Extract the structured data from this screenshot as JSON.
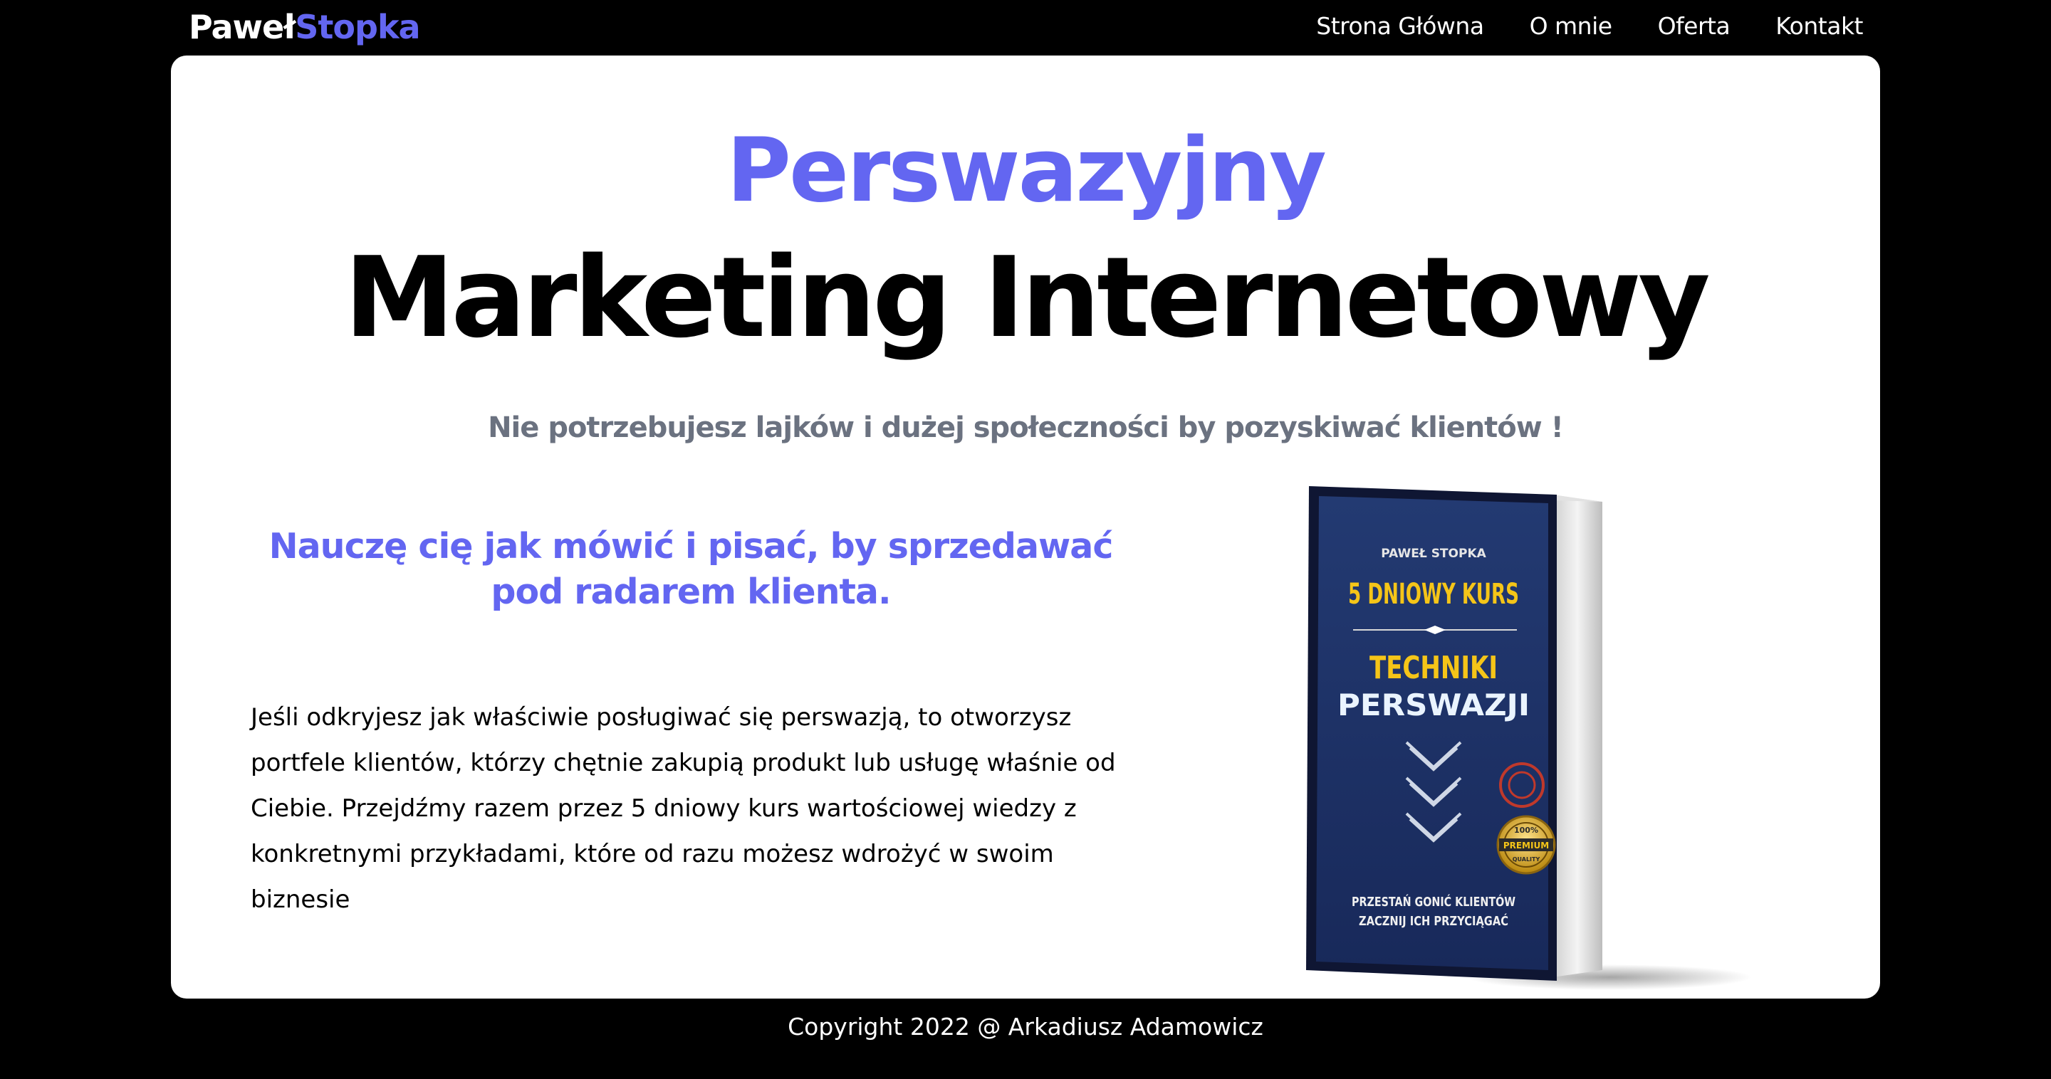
{
  "header": {
    "logo_first": "Paweł",
    "logo_second": "Stopka",
    "nav": [
      {
        "label": "Strona Główna"
      },
      {
        "label": "O mnie"
      },
      {
        "label": "Oferta"
      },
      {
        "label": "Kontakt"
      }
    ]
  },
  "hero": {
    "accent": "Perswazyjny",
    "title": "Marketing Internetowy",
    "subtitle": "Nie potrzebujesz lajków i dużej społeczności by pozyskiwać klientów !"
  },
  "offer": {
    "heading": "Nauczę cię jak mówić i pisać, by sprzedawać pod radarem klienta.",
    "text": "Jeśli odkryjesz jak właściwie posługiwać się perswazją, to otworzysz portfele klientów, którzy chętnie zakupią produkt lub usługę właśnie od Ciebie. Przejdźmy razem przez 5 dniowy kurs wartościowej wiedzy z konkretnymi przykładami, które od razu możesz wdrożyć w swoim biznesie"
  },
  "book": {
    "author": "PAWEŁ STOPKA",
    "course": "5 DNIOWY KURS",
    "title_line1": "TECHNIKI",
    "title_line2": "PERSWAZJI",
    "badge_top": "100%",
    "badge_middle": "PREMIUM",
    "badge_bottom": "QUALITY",
    "tagline_line1": "PRZESTAŃ GONIĆ KLIENTÓW",
    "tagline_line2": "ZACZNIJ ICH PRZYCIĄGAĆ"
  },
  "footer": {
    "copyright": "Copyright 2022 @ Arkadiusz Adamowicz"
  },
  "colors": {
    "accent": "#6366f1",
    "background": "#000000",
    "card": "#ffffff",
    "subtitle_gray": "#6b7280",
    "book_cover": "#1e3266",
    "book_yellow": "#f5c518"
  }
}
